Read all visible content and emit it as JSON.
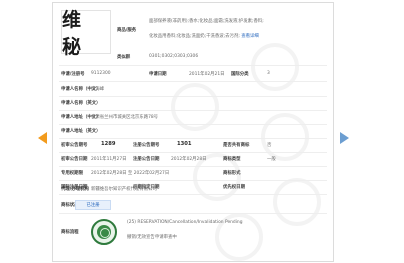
{
  "brand": {
    "mark_text": "维 秘"
  },
  "colors": {
    "prev_arrow": "#f29b1d",
    "next_arrow": "#6c9ed1",
    "link": "#2d6bbf",
    "seal_green": "#2f7a3d"
  },
  "icons": {
    "prev": "left-arrow-icon",
    "next": "right-arrow-icon",
    "seal": "certificate-seal-icon"
  },
  "fields": {
    "class_label": "商品/服务",
    "class_text_1": "面部保养液(非药用);香水;化妆品;面霜;洗发液;护发素;香料;",
    "class_text_2": "化妆品用香料;化妆品;洗面奶;干洗香波;去污剂;",
    "class_link": "查看详细",
    "group_label": "类似群",
    "group_value": "0301;0302;0303;0306",
    "reg_no_label": "申请/注册号",
    "reg_no_value": "9112300",
    "apply_date_label": "申请日期",
    "apply_date_value": "2011年02月21日",
    "intl_class_label": "国际分类",
    "intl_class_value": "3",
    "applicant_cn_label": "申请人名称（中文）",
    "applicant_cn_value": "吴海峰",
    "applicant_en_label": "申请人名称（英文）",
    "applicant_en_value": "",
    "address_cn_label": "申请人地址（中文）",
    "address_cn_value": "甘肃省兰州市城关区北京东路78号",
    "address_en_label": "申请人地址（英文）",
    "address_en_value": "",
    "prelim_no_label": "初审公告期号",
    "prelim_no_value": "1289",
    "reg_issue_label": "注册公告期号",
    "reg_issue_value": "1301",
    "shared_label": "是否共有商标",
    "shared_value": "否",
    "prelim_date_label": "初审公告日期",
    "prelim_date_value": "2011年11月27日",
    "reg_date_label": "注册公告日期",
    "reg_date_value": "2012年02月28日",
    "tm_type_label": "商标类型",
    "tm_type_value": "一般",
    "exclusive_label": "专用权期限",
    "exclusive_value": "2012年02月28日 至 2022年02月27日",
    "tm_form_label": "商标形式",
    "tm_form_value": "",
    "intl_reg_label": "国际注册日期",
    "intl_reg_value": "",
    "later_label": "后期指定日期",
    "later_value": "",
    "priority_label": "优先权日期",
    "priority_value": "",
    "agent_label": "代理/办理机构",
    "agent_value": "新疆维吾尔知识产权代理有限公司",
    "status_label": "商标状态",
    "status_tag": "已注册",
    "flow_label": "商标流程",
    "flow_text_1": "(25) RESERVATION/Cancellation/Invalidation Pending",
    "flow_text_2": "撤销/无效宣告申请审查中"
  }
}
